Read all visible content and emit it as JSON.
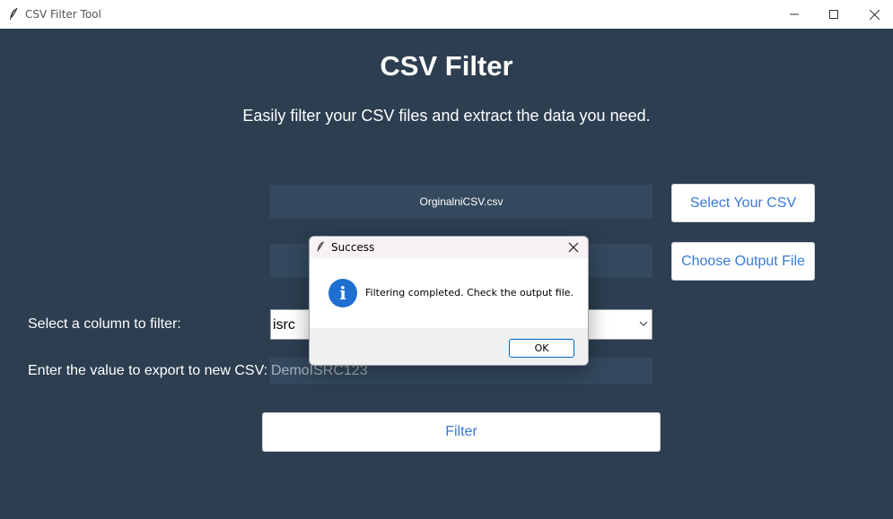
{
  "window": {
    "title": "CSV Filter Tool",
    "icon": "feather-icon",
    "controls": [
      "minimize-icon",
      "maximize-icon",
      "close-icon"
    ]
  },
  "app": {
    "heading": "CSV Filter",
    "subheading": "Easily filter your CSV files and extract the data you need.",
    "input_path": "OrginalniCSV.csv",
    "output_path": "",
    "select_csv_label": "Select Your CSV",
    "choose_output_label": "Choose Output File",
    "column_label": "Select a column to filter:",
    "column_value": "isrc",
    "value_label": "Enter the value to export to new CSV:",
    "value_text": "DemoISRC123",
    "filter_label": "Filter"
  },
  "dialog": {
    "title": "Success",
    "message": "Filtering completed. Check the output file.",
    "icon": "info-icon",
    "ok_label": "OK"
  },
  "colors": {
    "background": "#2c3e50",
    "field_background": "#34495e",
    "button_text": "#3a7bd5",
    "info_blue": "#1e6fd0"
  }
}
